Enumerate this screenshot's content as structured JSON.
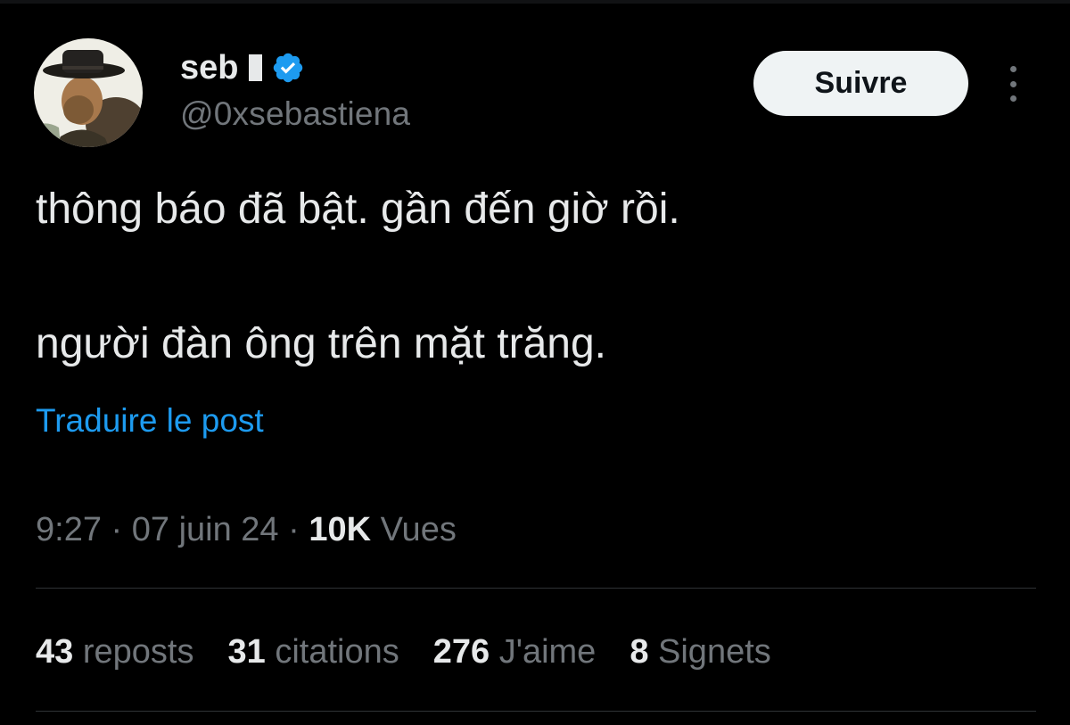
{
  "author": {
    "display_name": "seb",
    "handle": "@0xsebastiena",
    "verified": true
  },
  "follow_label": "Suivre",
  "tweet": {
    "line1": "thông báo đã bật. gần đến giờ rồi.",
    "line2": "người đàn ông trên mặt trăng."
  },
  "translate_label": "Traduire le post",
  "meta": {
    "time": "9:27",
    "separator": " · ",
    "date": "07 juin 24",
    "views_count": "10K",
    "views_label": "Vues"
  },
  "stats": [
    {
      "value": "43",
      "label": "reposts"
    },
    {
      "value": "31",
      "label": "citations"
    },
    {
      "value": "276",
      "label": "J'aime"
    },
    {
      "value": "8",
      "label": "Signets"
    }
  ],
  "colors": {
    "background": "#000000",
    "text": "#e7e9ea",
    "muted": "#71767b",
    "link": "#1d9bf0",
    "verified": "#1d9bf0",
    "button_bg": "#eff3f4",
    "divider": "#2f3336"
  },
  "icons": {
    "verified": "verified-badge-icon",
    "more": "more-options-icon"
  }
}
